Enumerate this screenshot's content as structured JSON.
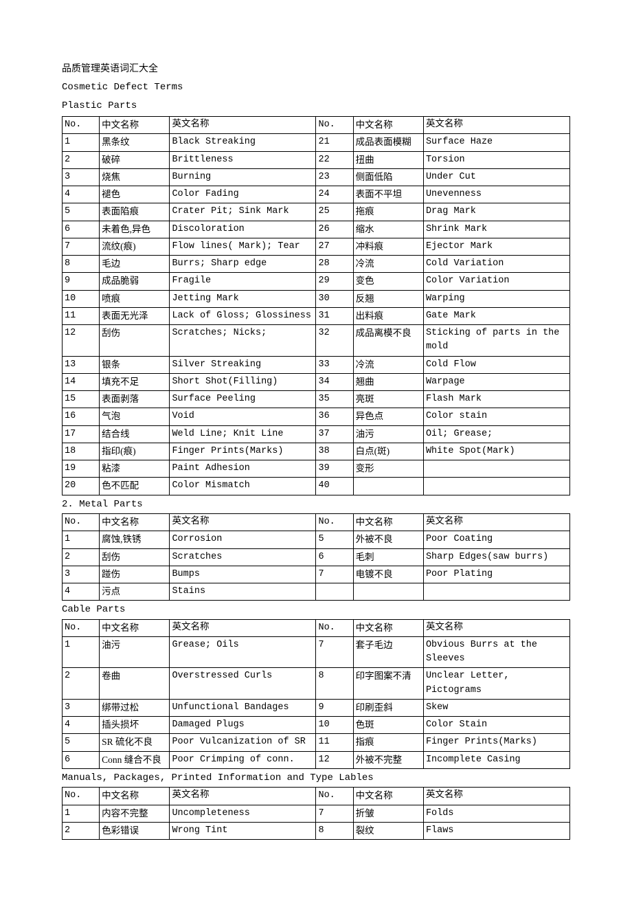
{
  "title_cn": "品质管理英语词汇大全",
  "title_en1": "Cosmetic Defect Terms",
  "title_en2": "Plastic Parts",
  "headers": {
    "no": "No.",
    "cn": "中文名称",
    "en": "英文名称"
  },
  "plastic_rows": [
    {
      "n1": "1",
      "c1": "黑条纹",
      "e1": "Black Streaking",
      "n2": "21",
      "c2": "成品表面模糊",
      "e2": "Surface Haze"
    },
    {
      "n1": "2",
      "c1": "破碎",
      "e1": "Brittleness",
      "n2": "22",
      "c2": "扭曲",
      "e2": "Torsion"
    },
    {
      "n1": "3",
      "c1": "烧焦",
      "e1": "Burning",
      "n2": "23",
      "c2": "侧面低陷",
      "e2": "Under Cut"
    },
    {
      "n1": "4",
      "c1": "褪色",
      "e1": "Color Fading",
      "n2": "24",
      "c2": "表面不平坦",
      "e2": "Unevenness"
    },
    {
      "n1": "5",
      "c1": "表面陷痕",
      "e1": "Crater Pit; Sink Mark",
      "n2": "25",
      "c2": "拖痕",
      "e2": "Drag Mark"
    },
    {
      "n1": "6",
      "c1": "未着色,异色",
      "e1": "Discoloration",
      "n2": "26",
      "c2": "缩水",
      "e2": "Shrink Mark"
    },
    {
      "n1": "7",
      "c1": "流纹(痕)",
      "e1": "Flow lines( Mark); Tear",
      "n2": "27",
      "c2": "冲料痕",
      "e2": "Ejector Mark"
    },
    {
      "n1": "8",
      "c1": "毛边",
      "e1": "Burrs; Sharp edge",
      "n2": "28",
      "c2": "冷流",
      "e2": "Cold Variation"
    },
    {
      "n1": "9",
      "c1": "成品脆弱",
      "e1": "Fragile",
      "n2": "29",
      "c2": "变色",
      "e2": "Color Variation"
    },
    {
      "n1": "10",
      "c1": "喷痕",
      "e1": "Jetting Mark",
      "n2": "30",
      "c2": "反翘",
      "e2": "Warping"
    },
    {
      "n1": "11",
      "c1": "表面无光泽",
      "e1": "Lack   of   Gloss; Glossiness",
      "n2": "31",
      "c2": "出料痕",
      "e2": "Gate Mark"
    },
    {
      "n1": "12",
      "c1": "刮伤",
      "e1": "Scratches; Nicks;",
      "n2": "32",
      "c2": "成品离模不良",
      "e2": "Sticking of parts in the mold"
    },
    {
      "n1": "13",
      "c1": "银条",
      "e1": "Silver Streaking",
      "n2": "33",
      "c2": "冷流",
      "e2": "Cold Flow"
    },
    {
      "n1": "14",
      "c1": "填充不足",
      "e1": "Short Shot(Filling)",
      "n2": "34",
      "c2": "翘曲",
      "e2": "Warpage"
    },
    {
      "n1": "15",
      "c1": "表面剥落",
      "e1": "Surface Peeling",
      "n2": "35",
      "c2": "亮斑",
      "e2": "Flash Mark"
    },
    {
      "n1": "16",
      "c1": "气泡",
      "e1": "Void",
      "n2": "36",
      "c2": "异色点",
      "e2": "Color stain"
    },
    {
      "n1": "17",
      "c1": "结合线",
      "e1": "Weld Line; Knit Line",
      "n2": "37",
      "c2": "油污",
      "e2": "Oil; Grease;"
    },
    {
      "n1": "18",
      "c1": "指印(痕)",
      "e1": "Finger Prints(Marks)",
      "n2": "38",
      "c2": "白点(斑)",
      "e2": "White Spot(Mark)"
    },
    {
      "n1": "19",
      "c1": "粘漆",
      "e1": "Paint Adhesion",
      "n2": "39",
      "c2": "变形",
      "e2": ""
    },
    {
      "n1": "20",
      "c1": "色不匹配",
      "e1": "Color Mismatch",
      "n2": "40",
      "c2": "",
      "e2": ""
    }
  ],
  "section2": "2. Metal Parts",
  "metal_rows": [
    {
      "n1": "1",
      "c1": "腐蚀,铁锈",
      "e1": "Corrosion",
      "n2": "5",
      "c2": "外被不良",
      "e2": "Poor Coating"
    },
    {
      "n1": "2",
      "c1": "刮伤",
      "e1": "Scratches",
      "n2": "6",
      "c2": "毛刺",
      "e2": "Sharp Edges(saw burrs)"
    },
    {
      "n1": "3",
      "c1": "踫伤",
      "e1": "Bumps",
      "n2": "7",
      "c2": "电镀不良",
      "e2": "Poor Plating"
    },
    {
      "n1": "4",
      "c1": "污点",
      "e1": "Stains",
      "n2": "",
      "c2": "",
      "e2": ""
    }
  ],
  "section3": "Cable Parts",
  "cable_rows": [
    {
      "n1": "1",
      "c1": "油污",
      "e1": "Grease; Oils",
      "n2": "7",
      "c2": "套子毛边",
      "e2": "Obvious Burrs at the Sleeves"
    },
    {
      "n1": "2",
      "c1": "卷曲",
      "e1": "Overstressed Curls",
      "n2": "8",
      "c2": "印字图案不清",
      "e2": "Unclear Letter, Pictograms"
    },
    {
      "n1": "3",
      "c1": "绑带过松",
      "e1": "Unfunctional Bandages",
      "n2": "9",
      "c2": "印刷歪斜",
      "e2": "Skew"
    },
    {
      "n1": "4",
      "c1": "插头损坏",
      "e1": "Damaged Plugs",
      "n2": "10",
      "c2": "色斑",
      "e2": "Color Stain"
    },
    {
      "n1": "5",
      "c1": "SR 硫化不良",
      "e1": "Poor Vulcanization of SR",
      "n2": "11",
      "c2": "指痕",
      "e2": "Finger Prints(Marks)"
    },
    {
      "n1": "6",
      "c1": "Conn 缝合不良",
      "e1": "Poor Crimping of conn.",
      "n2": "12",
      "c2": "外被不完整",
      "e2": "Incomplete Casing"
    }
  ],
  "section4": "Manuals, Packages, Printed Information and Type Lables",
  "manual_rows": [
    {
      "n1": "1",
      "c1": "内容不完整",
      "e1": "Uncompleteness",
      "n2": "7",
      "c2": "折皱",
      "e2": "Folds"
    },
    {
      "n1": "2",
      "c1": "色彩错误",
      "e1": "Wrong Tint",
      "n2": "8",
      "c2": "裂纹",
      "e2": "Flaws"
    }
  ]
}
